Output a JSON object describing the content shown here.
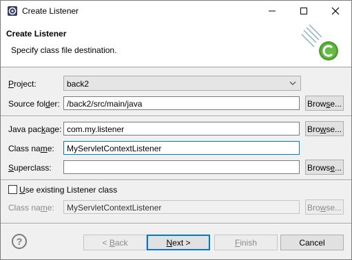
{
  "window": {
    "title": "Create Listener"
  },
  "icons": {
    "app": "eclipse-app-icon",
    "logo": "eclipse-class-wizard-logo",
    "help": "help-icon"
  },
  "banner": {
    "title": "Create Listener",
    "description": "Specify class file destination."
  },
  "form": {
    "project": {
      "label_pre": "",
      "label_u": "P",
      "label_post": "roject:",
      "value": "back2"
    },
    "source_folder": {
      "label_pre": "Source fol",
      "label_u": "d",
      "label_post": "er:",
      "value": "/back2/src/main/java",
      "browse_pre": "Brow",
      "browse_u": "s",
      "browse_post": "e..."
    },
    "java_package": {
      "label_pre": "Java pac",
      "label_u": "k",
      "label_post": "age:",
      "value": "com.my.listener",
      "browse_pre": "Bro",
      "browse_u": "w",
      "browse_post": "se..."
    },
    "class_name": {
      "label_pre": "Class na",
      "label_u": "m",
      "label_post": "e:",
      "value": "MyServletContextListener"
    },
    "superclass": {
      "label_pre": "",
      "label_u": "S",
      "label_post": "uperclass:",
      "value": "",
      "browse_pre": "Brows",
      "browse_u": "e",
      "browse_post": "..."
    },
    "use_existing": {
      "label_pre": "",
      "label_u": "U",
      "label_post": "se existing Listener class",
      "checked": false
    },
    "existing_class_name": {
      "label_pre": "Class na",
      "label_u": "m",
      "label_post": "e:",
      "value": "MyServletContextListener",
      "browse_pre": "Bro",
      "browse_u": "w",
      "browse_post": "se..."
    }
  },
  "footer": {
    "back": {
      "pre": "< ",
      "u": "B",
      "post": "ack"
    },
    "next": {
      "pre": "",
      "u": "N",
      "post": "ext >"
    },
    "finish": {
      "pre": "",
      "u": "F",
      "post": "inish"
    },
    "cancel": {
      "label": "Cancel"
    }
  }
}
